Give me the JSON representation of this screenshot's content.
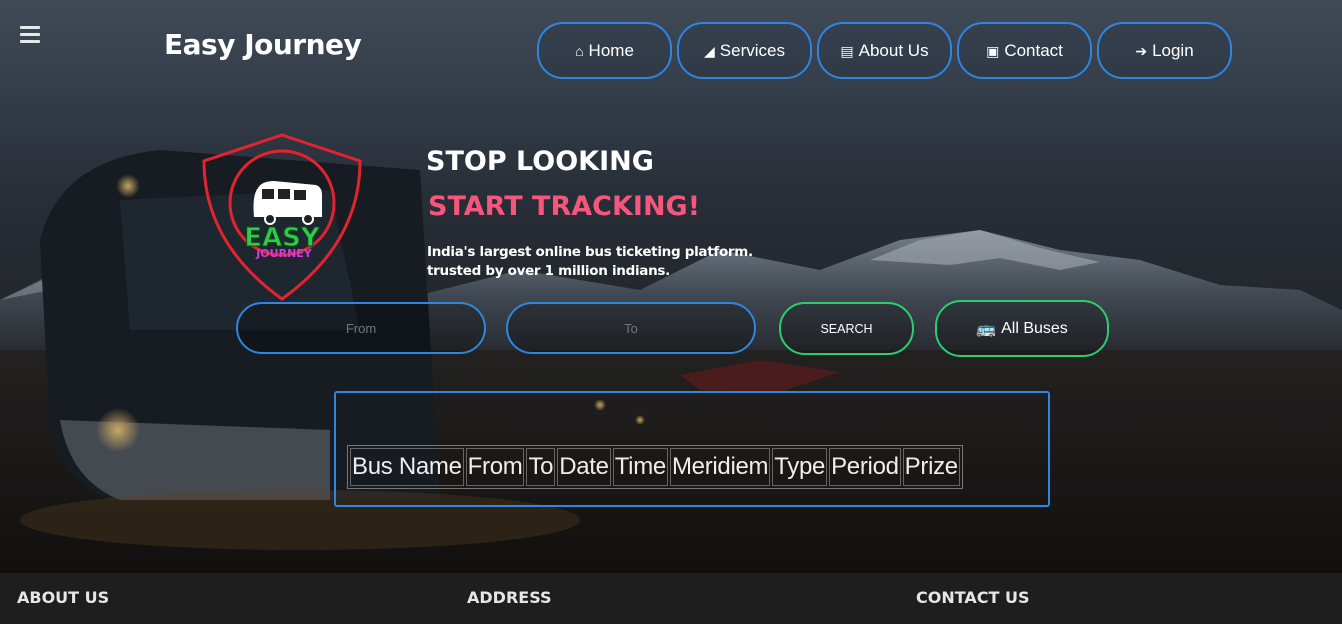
{
  "brand": "Easy Journey",
  "nav": [
    {
      "label": "Home",
      "icon": "home-icon"
    },
    {
      "label": "Services",
      "icon": "services-icon"
    },
    {
      "label": "About Us",
      "icon": "id-card-icon"
    },
    {
      "label": "Contact",
      "icon": "contact-icon"
    },
    {
      "label": "Login",
      "icon": "login-icon"
    }
  ],
  "logo": {
    "line1": "EASY",
    "line2": "JOURNEY"
  },
  "hero": {
    "headline": "STOP LOOKING",
    "subheadline": "START TRACKING!",
    "tagline1": "India's largest online bus ticketing platform.",
    "tagline2": "trusted by over 1 million indians."
  },
  "search": {
    "from_placeholder": "From",
    "to_placeholder": "To",
    "search_label": "SEARCH",
    "all_buses_label": "All Buses"
  },
  "table": {
    "headers": [
      "Bus Name",
      "From",
      "To",
      "Date",
      "Time",
      "Meridiem",
      "Type",
      "Period",
      "Prize"
    ]
  },
  "footer": {
    "about": "ABOUT US",
    "address": "ADDRESS",
    "contact": "CONTACT US"
  },
  "colors": {
    "accent_blue": "#2e86de",
    "accent_green": "#2ecc71",
    "accent_pink": "#f4567c"
  }
}
